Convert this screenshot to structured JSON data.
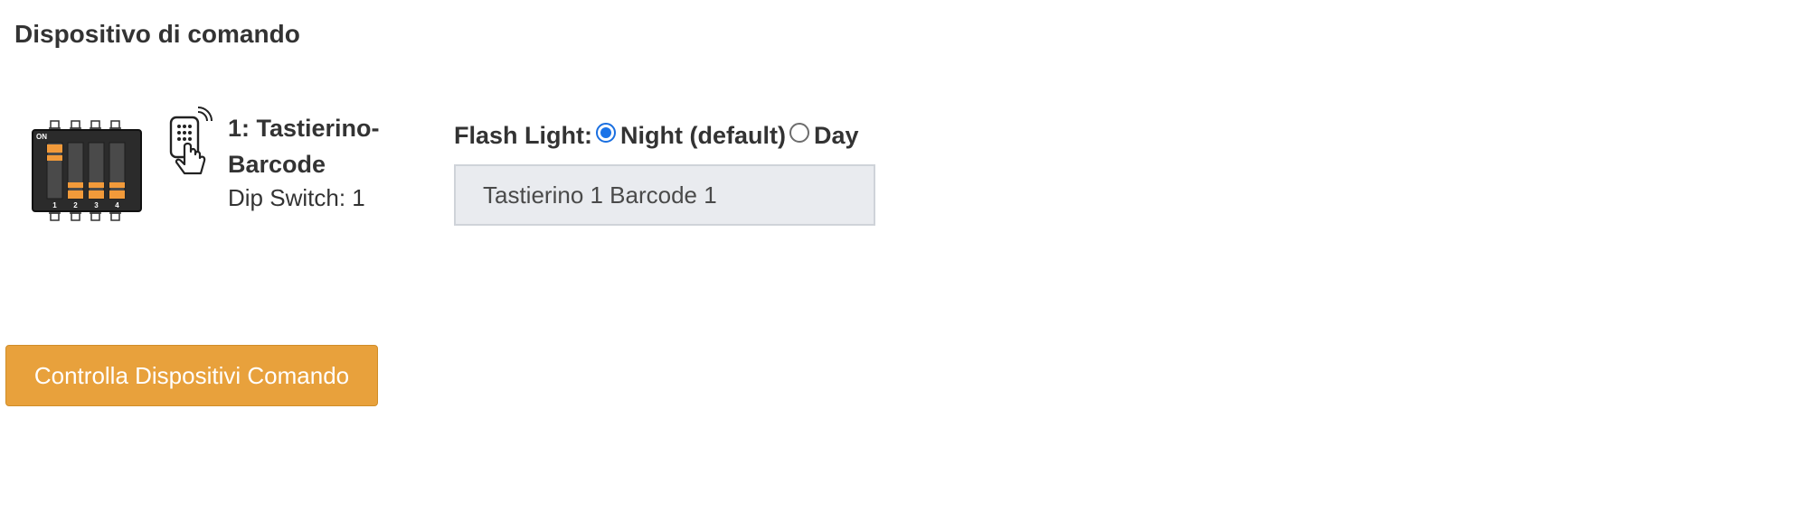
{
  "section": {
    "title": "Dispositivo di comando"
  },
  "device": {
    "name": "1: Tastierino-Barcode",
    "dip_label": "Dip Switch: 1",
    "dip_switch": {
      "on_label": "ON",
      "switch_numbers": [
        "1",
        "2",
        "3",
        "4"
      ],
      "switch_states": [
        "on",
        "off",
        "off",
        "off"
      ],
      "accent_color": "#f29a3a"
    },
    "icon": "keypad-remote-icon"
  },
  "flash_light": {
    "label": "Flash Light:",
    "options": [
      {
        "label": "Night (default)",
        "selected": true
      },
      {
        "label": "Day",
        "selected": false
      }
    ]
  },
  "name_field": {
    "value": "Tastierino 1 Barcode 1"
  },
  "actions": {
    "check_button_label": "Controlla Dispositivi Comando",
    "button_color": "#e8a13c"
  }
}
